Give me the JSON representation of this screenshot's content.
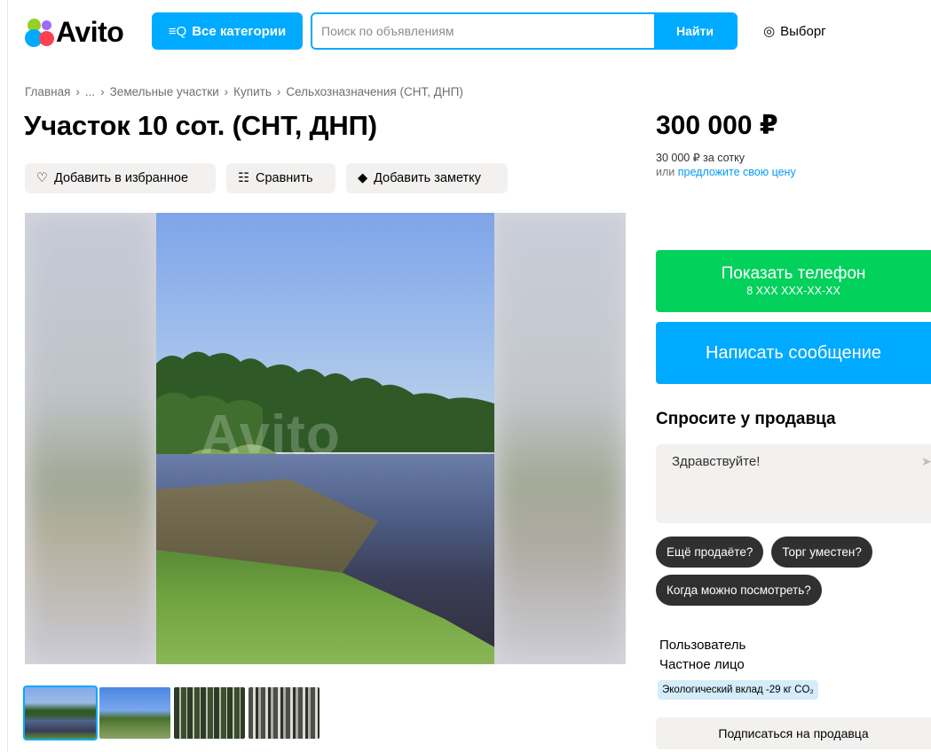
{
  "header": {
    "logo_text": "Avito",
    "categories_label": "Все категории",
    "categories_icon": "≡Q",
    "search": {
      "placeholder": "Поиск по объявлениям",
      "value": ""
    },
    "search_button": "Найти",
    "location": "Выборг",
    "location_icon": "◎"
  },
  "breadcrumb": {
    "items": [
      "Главная",
      "...",
      "Земельные участки",
      "Купить",
      "Сельхозназначения (СНТ, ДНП)"
    ],
    "separator": "›"
  },
  "listing": {
    "title": "Участок 10 сот. (СНТ, ДНП)",
    "actions": [
      {
        "label": "Добавить в избранное",
        "icon": "♡"
      },
      {
        "label": "Сравнить",
        "icon": "☷"
      },
      {
        "label": "Добавить заметку",
        "icon": "◆"
      }
    ],
    "watermark": "Avito",
    "thumbnails_count": 4
  },
  "pricing": {
    "price": "300 000 ₽",
    "per_unit": "30 000 ₽ за сотку",
    "offer_prefix": "или",
    "offer_link": "предложите свою цену"
  },
  "contact": {
    "phone_button": "Показать телефон",
    "phone_masked": "8 XXX XXX-XX-XX",
    "message_button": "Написать сообщение"
  },
  "ask_seller": {
    "title": "Спросите у продавца",
    "message_text": "Здравствуйте!",
    "send_icon": "➤",
    "quick_questions": [
      "Ещё продаёте?",
      "Торг уместен?",
      "Когда можно посмотреть?"
    ]
  },
  "seller": {
    "name": "Пользователь",
    "type": "Частное лицо",
    "eco_badge": "Экологический вклад -29 кг CO₂",
    "subscribe_button": "Подписаться на продавца"
  },
  "colors": {
    "accent": "#00aaff",
    "phone_green": "#02d15c",
    "chip_dark": "#303030",
    "action_bg": "#f2f1f0"
  }
}
